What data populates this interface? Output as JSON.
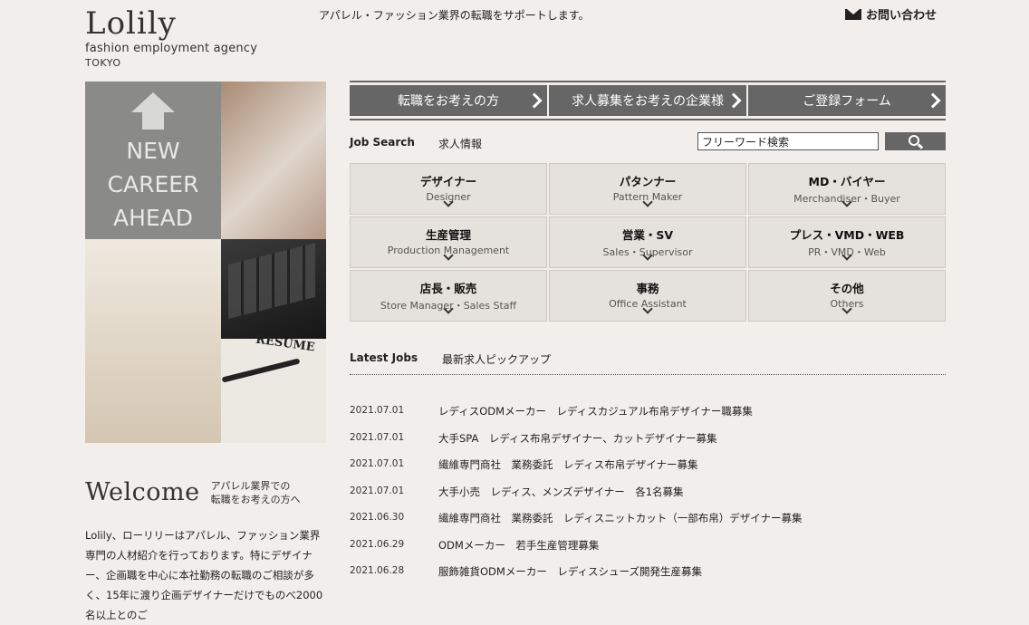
{
  "header": {
    "brand": "Lolily",
    "brand_sub": "fashion employment agency",
    "brand_city": "TOKYO",
    "tagline": "アパレル・ファッション業界の転職をサポートします。",
    "contact_label": "お問い合わせ",
    "contact_icon": "mail-icon"
  },
  "hero": {
    "text_lines": [
      "NEW",
      "CAREER",
      "AHEAD"
    ],
    "resume_label": "RESUME"
  },
  "nav": [
    {
      "label": "転職をお考えの方"
    },
    {
      "label": "求人募集をお考えの企業様"
    },
    {
      "label": "ご登録フォーム"
    }
  ],
  "search": {
    "label_en": "Job Search",
    "label_jp": "求人情報",
    "placeholder": "フリーワード検索",
    "button_icon": "search-icon"
  },
  "categories": [
    {
      "jp": "デザイナー",
      "en": "Designer"
    },
    {
      "jp": "パタンナー",
      "en": "Pattern Maker"
    },
    {
      "jp": "MD・バイヤー",
      "en": "Merchandiser・Buyer"
    },
    {
      "jp": "生産管理",
      "en": "Production Management"
    },
    {
      "jp": "営業・SV",
      "en": "Sales・Supervisor"
    },
    {
      "jp": "プレス・VMD・WEB",
      "en": "PR・VMD・Web"
    },
    {
      "jp": "店長・販売",
      "en": "Store Manager・Sales Staff"
    },
    {
      "jp": "事務",
      "en": "Office Assistant"
    },
    {
      "jp": "その他",
      "en": "Others"
    }
  ],
  "latest": {
    "label_en": "Latest Jobs",
    "label_jp": "最新求人ピックアップ",
    "jobs": [
      {
        "date": "2021.07.01",
        "title": "レディスODMメーカー　レディスカジュアル布帛デザイナー職募集"
      },
      {
        "date": "2021.07.01",
        "title": "大手SPA　レディス布帛デザイナー、カットデザイナー募集"
      },
      {
        "date": "2021.07.01",
        "title": "繊維専門商社　業務委託　レディス布帛デザイナー募集"
      },
      {
        "date": "2021.07.01",
        "title": "大手小売　レディス、メンズデザイナー　各1名募集"
      },
      {
        "date": "2021.06.30",
        "title": "繊維専門商社　業務委託　レディスニットカット（一部布帛）デザイナー募集"
      },
      {
        "date": "2021.06.29",
        "title": "ODMメーカー　若手生産管理募集"
      },
      {
        "date": "2021.06.28",
        "title": "服飾雑貨ODMメーカー　レディスシューズ開発生産募集"
      }
    ]
  },
  "welcome": {
    "title": "Welcome",
    "subtitle_line1": "アパレル業界での",
    "subtitle_line2": "転職をお考えの方へ",
    "intro": "Lolily、ローリリーはアパレル、ファッション業界専門の人材紹介を行っております。特にデザイナー、企画職を中心に本社勤務の転職のご相談が多く、15年に渡り企画デザイナーだけでものべ2000名以上とのご"
  }
}
